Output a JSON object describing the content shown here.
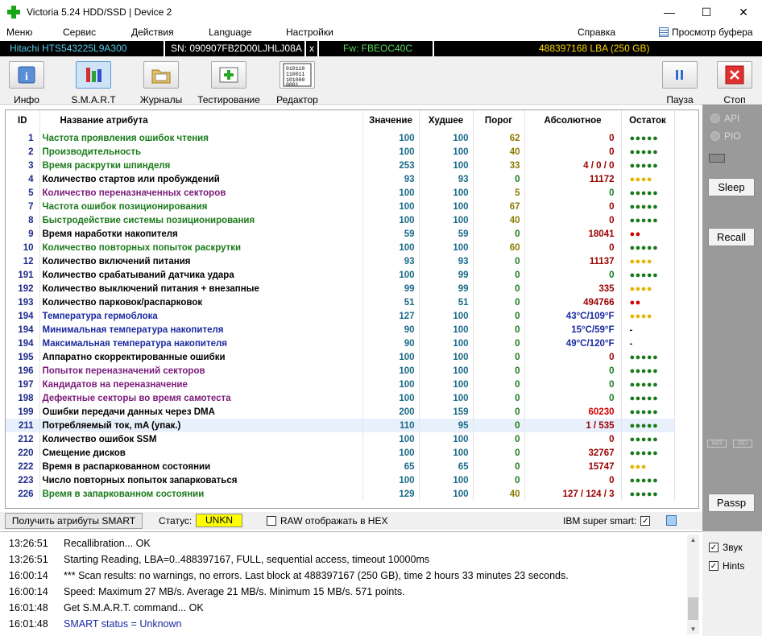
{
  "window": {
    "title": "Victoria 5.24 HDD/SSD | Device 2",
    "minimize": "—",
    "maximize": "☐",
    "close": "✕"
  },
  "menu": {
    "items": [
      "Меню",
      "Сервис",
      "Действия",
      "Language",
      "Настройки",
      "Справка"
    ],
    "clipboard": "Просмотр буфера"
  },
  "device": {
    "model": "Hitachi HTS543225L9A300",
    "serial": "SN: 090907FB2D00LJHLJ08A",
    "close": "x",
    "firmware": "Fw: FBEOC40C",
    "lba": "488397168 LBA (250 GB)"
  },
  "toolbar": {
    "info": "Инфо",
    "smart": "S.M.A.R.T",
    "journals": "Журналы",
    "testing": "Тестирование",
    "editor": "Редактор",
    "pause": "Пауза",
    "stop": "Стоп",
    "editor_glyph": "010110\n110011\n101000\n0001"
  },
  "table": {
    "headers": [
      "ID",
      "Название атрибута",
      "Значение",
      "Худшее",
      "Порог",
      "Абсолютное",
      "Остаток"
    ],
    "rows": [
      {
        "id": "1",
        "name": "Частота проявления ошибок чтения",
        "val": "100",
        "worst": "100",
        "thr": "62",
        "abs": "0",
        "rem": "●●●●●",
        "nc": "#1a7a1a",
        "ac": "#9a0000",
        "rc": "#1a7a1a",
        "tc": "#8c7a00"
      },
      {
        "id": "2",
        "name": "Производительность",
        "val": "100",
        "worst": "100",
        "thr": "40",
        "abs": "0",
        "rem": "●●●●●",
        "nc": "#1a7a1a",
        "ac": "#9a0000",
        "rc": "#1a7a1a",
        "tc": "#8c7a00"
      },
      {
        "id": "3",
        "name": "Время раскрутки шпинделя",
        "val": "253",
        "worst": "100",
        "thr": "33",
        "abs": "4 / 0 / 0",
        "rem": "●●●●●",
        "nc": "#1a7a1a",
        "ac": "#9a0000",
        "rc": "#1a7a1a",
        "tc": "#8c7a00"
      },
      {
        "id": "4",
        "name": "Количество стартов или пробуждений",
        "val": "93",
        "worst": "93",
        "thr": "0",
        "abs": "11172",
        "rem": "●●●●",
        "nc": "#000000",
        "ac": "#9a0000",
        "rc": "#e8b400",
        "tc": "#1a7a1a"
      },
      {
        "id": "5",
        "name": "Количество переназначенных секторов",
        "val": "100",
        "worst": "100",
        "thr": "5",
        "abs": "0",
        "rem": "●●●●●",
        "nc": "#7a1a7a",
        "ac": "#1a7a1a",
        "rc": "#1a7a1a",
        "tc": "#8c7a00"
      },
      {
        "id": "7",
        "name": "Частота ошибок позиционирования",
        "val": "100",
        "worst": "100",
        "thr": "67",
        "abs": "0",
        "rem": "●●●●●",
        "nc": "#1a7a1a",
        "ac": "#9a0000",
        "rc": "#1a7a1a",
        "tc": "#8c7a00"
      },
      {
        "id": "8",
        "name": "Быстродействие системы позиционирования",
        "val": "100",
        "worst": "100",
        "thr": "40",
        "abs": "0",
        "rem": "●●●●●",
        "nc": "#1a7a1a",
        "ac": "#9a0000",
        "rc": "#1a7a1a",
        "tc": "#8c7a00"
      },
      {
        "id": "9",
        "name": "Время наработки накопителя",
        "val": "59",
        "worst": "59",
        "thr": "0",
        "abs": "18041",
        "rem": "●●",
        "nc": "#000000",
        "ac": "#9a0000",
        "rc": "#d00000",
        "tc": "#1a7a1a"
      },
      {
        "id": "10",
        "name": "Количество повторных попыток раскрутки",
        "val": "100",
        "worst": "100",
        "thr": "60",
        "abs": "0",
        "rem": "●●●●●",
        "nc": "#1a7a1a",
        "ac": "#9a0000",
        "rc": "#1a7a1a",
        "tc": "#8c7a00"
      },
      {
        "id": "12",
        "name": "Количество включений питания",
        "val": "93",
        "worst": "93",
        "thr": "0",
        "abs": "11137",
        "rem": "●●●●",
        "nc": "#000000",
        "ac": "#9a0000",
        "rc": "#e8b400",
        "tc": "#1a7a1a"
      },
      {
        "id": "191",
        "name": "Количество срабатываний датчика удара",
        "val": "100",
        "worst": "99",
        "thr": "0",
        "abs": "0",
        "rem": "●●●●●",
        "nc": "#000000",
        "ac": "#1a7a1a",
        "rc": "#1a7a1a",
        "tc": "#1a7a1a"
      },
      {
        "id": "192",
        "name": "Количество выключений питания + внезапные",
        "val": "99",
        "worst": "99",
        "thr": "0",
        "abs": "335",
        "rem": "●●●●",
        "nc": "#000000",
        "ac": "#9a0000",
        "rc": "#e8b400",
        "tc": "#1a7a1a"
      },
      {
        "id": "193",
        "name": "Количество парковок/распарковок",
        "val": "51",
        "worst": "51",
        "thr": "0",
        "abs": "494766",
        "rem": "●●",
        "nc": "#000000",
        "ac": "#9a0000",
        "rc": "#d00000",
        "tc": "#1a7a1a"
      },
      {
        "id": "194",
        "name": "Температура гермоблока",
        "val": "127",
        "worst": "100",
        "thr": "0",
        "abs": "43°C/109°F",
        "rem": "●●●●",
        "nc": "#1a2aa0",
        "ac": "#1a2aa0",
        "rc": "#e8b400",
        "tc": "#1a7a1a"
      },
      {
        "id": "194",
        "name": "Минимальная температура накопителя",
        "val": "90",
        "worst": "100",
        "thr": "0",
        "abs": "15°C/59°F",
        "rem": "-",
        "nc": "#1a2aa0",
        "ac": "#1a2aa0",
        "rc": "#000000",
        "tc": "#1a7a1a"
      },
      {
        "id": "194",
        "name": "Максимальная температура накопителя",
        "val": "90",
        "worst": "100",
        "thr": "0",
        "abs": "49°C/120°F",
        "rem": "-",
        "nc": "#1a2aa0",
        "ac": "#1a2aa0",
        "rc": "#000000",
        "tc": "#1a7a1a"
      },
      {
        "id": "195",
        "name": "Аппаратно скорректированные ошибки",
        "val": "100",
        "worst": "100",
        "thr": "0",
        "abs": "0",
        "rem": "●●●●●",
        "nc": "#000000",
        "ac": "#9a0000",
        "rc": "#1a7a1a",
        "tc": "#1a7a1a"
      },
      {
        "id": "196",
        "name": "Попыток переназначений секторов",
        "val": "100",
        "worst": "100",
        "thr": "0",
        "abs": "0",
        "rem": "●●●●●",
        "nc": "#7a1a7a",
        "ac": "#1a7a1a",
        "rc": "#1a7a1a",
        "tc": "#1a7a1a"
      },
      {
        "id": "197",
        "name": "Кандидатов на переназначение",
        "val": "100",
        "worst": "100",
        "thr": "0",
        "abs": "0",
        "rem": "●●●●●",
        "nc": "#7a1a7a",
        "ac": "#1a7a1a",
        "rc": "#1a7a1a",
        "tc": "#1a7a1a"
      },
      {
        "id": "198",
        "name": "Дефектные секторы во время самотеста",
        "val": "100",
        "worst": "100",
        "thr": "0",
        "abs": "0",
        "rem": "●●●●●",
        "nc": "#7a1a7a",
        "ac": "#1a7a1a",
        "rc": "#1a7a1a",
        "tc": "#1a7a1a"
      },
      {
        "id": "199",
        "name": "Ошибки передачи данных через DMA",
        "val": "200",
        "worst": "159",
        "thr": "0",
        "abs": "60230",
        "rem": "●●●●●",
        "nc": "#000000",
        "ac": "#d00000",
        "rc": "#1a7a1a",
        "tc": "#1a7a1a"
      },
      {
        "id": "211",
        "name": "Потребляемый ток, mA (упак.)",
        "val": "110",
        "worst": "95",
        "thr": "0",
        "abs": "1 / 535",
        "rem": "●●●●●",
        "nc": "#000000",
        "ac": "#9a0000",
        "rc": "#1a7a1a",
        "tc": "#1a7a1a",
        "sel": true
      },
      {
        "id": "212",
        "name": "Количество ошибок SSM",
        "val": "100",
        "worst": "100",
        "thr": "0",
        "abs": "0",
        "rem": "●●●●●",
        "nc": "#000000",
        "ac": "#9a0000",
        "rc": "#1a7a1a",
        "tc": "#1a7a1a"
      },
      {
        "id": "220",
        "name": "Смещение дисков",
        "val": "100",
        "worst": "100",
        "thr": "0",
        "abs": "32767",
        "rem": "●●●●●",
        "nc": "#000000",
        "ac": "#9a0000",
        "rc": "#1a7a1a",
        "tc": "#1a7a1a"
      },
      {
        "id": "222",
        "name": "Время в распаркованном состоянии",
        "val": "65",
        "worst": "65",
        "thr": "0",
        "abs": "15747",
        "rem": "●●●",
        "nc": "#000000",
        "ac": "#9a0000",
        "rc": "#e8b400",
        "tc": "#1a7a1a"
      },
      {
        "id": "223",
        "name": "Число повторных попыток запарковаться",
        "val": "100",
        "worst": "100",
        "thr": "0",
        "abs": "0",
        "rem": "●●●●●",
        "nc": "#000000",
        "ac": "#9a0000",
        "rc": "#1a7a1a",
        "tc": "#1a7a1a"
      },
      {
        "id": "226",
        "name": "Время в запаркованном состоянии",
        "val": "129",
        "worst": "100",
        "thr": "40",
        "abs": "127 / 124 / 3",
        "rem": "●●●●●",
        "nc": "#1a7a1a",
        "ac": "#9a0000",
        "rc": "#1a7a1a",
        "tc": "#8c7a00"
      }
    ]
  },
  "right_panel": {
    "api": "API",
    "pio": "PIO",
    "sleep": "Sleep",
    "recall": "Recall",
    "wr": "WR",
    "rd": "RD",
    "passp": "Passp"
  },
  "status_bar": {
    "get_smart": "Получить атрибуты SMART",
    "status_label": "Статус:",
    "status_value": "UNKN",
    "raw_hex": "RAW отображать в HEX",
    "ibm_smart": "IBM super smart:",
    "ibm_checked": "✓"
  },
  "log": [
    {
      "time": "13:26:51",
      "msg": "Recallibration... OK",
      "color": "#000000"
    },
    {
      "time": "13:26:51",
      "msg": "Starting Reading, LBA=0..488397167, FULL, sequential access, timeout 10000ms",
      "color": "#000000"
    },
    {
      "time": "16:00:14",
      "msg": "*** Scan results: no warnings, no errors. Last block at 488397167 (250 GB), time 2 hours 33 minutes 23 seconds.",
      "color": "#000000"
    },
    {
      "time": "16:00:14",
      "msg": "Speed: Maximum 27 MB/s. Average 21 MB/s. Minimum 15 MB/s. 571 points.",
      "color": "#000000"
    },
    {
      "time": "16:01:48",
      "msg": "Get S.M.A.R.T. command... OK",
      "color": "#000000"
    },
    {
      "time": "16:01:48",
      "msg": "SMART status = Unknown",
      "color": "#1a2aa0"
    }
  ],
  "bottom_right": {
    "sound": "Звук",
    "hints": "Hints",
    "check": "✓"
  }
}
